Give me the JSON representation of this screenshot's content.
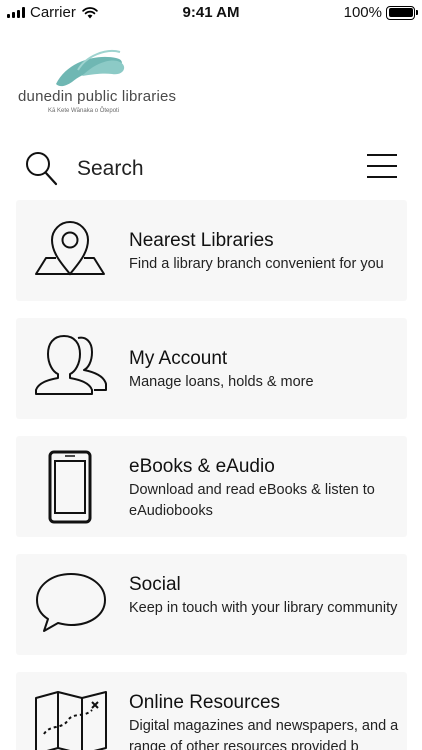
{
  "status_bar": {
    "carrier": "Carrier",
    "time": "9:41 AM",
    "battery": "100%",
    "battery_level": 1.0
  },
  "header": {
    "logo_text": "dunedin public libraries",
    "logo_subtext": "Kā Kete Wānaka o Ōtepoti",
    "logo_color": "#6fb7b3"
  },
  "search": {
    "label": "Search",
    "icon": "search-icon",
    "menu_icon": "hamburger-menu-icon"
  },
  "cards": [
    {
      "id": "nearest-libraries",
      "icon": "map-pin-icon",
      "title": "Nearest Libraries",
      "description": "Find a library branch convenient for you"
    },
    {
      "id": "my-account",
      "icon": "users-icon",
      "title": "My Account",
      "description": "Manage loans, holds & more"
    },
    {
      "id": "ebooks-eaudio",
      "icon": "smartphone-icon",
      "title": "eBooks & eAudio",
      "description": "Download and read eBooks & listen to eAudiobooks"
    },
    {
      "id": "social",
      "icon": "speech-bubble-icon",
      "title": "Social",
      "description": "Keep in touch with your library community"
    },
    {
      "id": "online-resources",
      "icon": "treasure-map-icon",
      "title": "Online Resources",
      "description": "Digital magazines and newspapers, and a range of other resources provided b"
    }
  ]
}
